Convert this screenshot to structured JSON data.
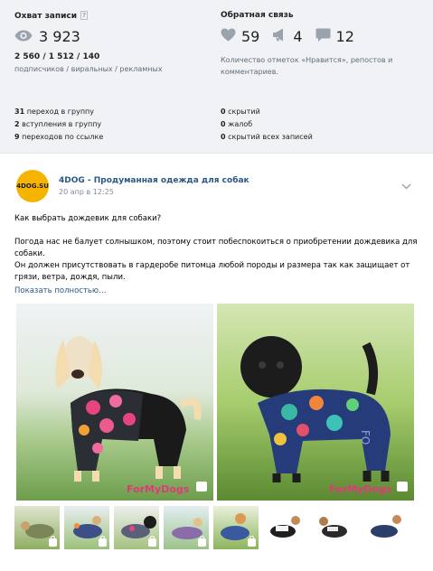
{
  "stats": {
    "reach_title": "Охват записи",
    "reach_help": "?",
    "reach_value": "3 923",
    "breakdown_value": "2 560 / 1 512 / 140",
    "breakdown_caption": "подписчиков / виральных / рекламных",
    "feedback_title": "Обратная связь",
    "likes": "59",
    "reposts": "4",
    "comments": "12",
    "feedback_caption": "Количество отметок «Нравится», репостов и комментариев.",
    "left_list": [
      {
        "n": "31",
        "label": "переход в группу"
      },
      {
        "n": "2",
        "label": "вступления в группу"
      },
      {
        "n": "9",
        "label": "переходов по ссылке"
      }
    ],
    "right_list": [
      {
        "n": "0",
        "label": "скрытий"
      },
      {
        "n": "0",
        "label": "жалоб"
      },
      {
        "n": "0",
        "label": "скрытий всех записей"
      }
    ]
  },
  "post": {
    "avatar_text": "4DOG.SU",
    "author": "4DOG - Продуманная одежда для собак",
    "date": "20 апр в 12:25",
    "line1": "Как выбрать дождевик для собаки?",
    "line2": "Погода нас не балует солнышком, поэтому стоит побеспокоиться о приобретении дождевика для собаки.",
    "line3": "Он должен присутствовать в гардеробе питомца любой породы и размера так как защищает от грязи, ветра, дождя, пыли.",
    "show_more": "Показать полностью…",
    "watermark": "ForMyDogs"
  },
  "colors": {
    "link": "#2a5885",
    "muted": "#626d7a",
    "icon": "#99a2ad",
    "stats_bg": "#f0f2f5"
  }
}
